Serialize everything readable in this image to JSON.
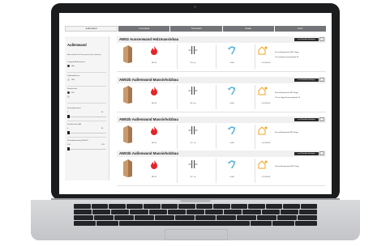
{
  "tabs": [
    {
      "label": "Außenwand",
      "active": true
    },
    {
      "label": "Innenwand",
      "active": false
    },
    {
      "label": "Trennwand",
      "active": false
    },
    {
      "label": "Decke",
      "active": false
    },
    {
      "label": "Dach",
      "active": false
    }
  ],
  "sidebar": {
    "title": "Außenwand",
    "description": "Bitte wählen Sie Ihre gewünschte Optionen",
    "group1_label": "Tragende Außenwand",
    "group1_opt": "Holz",
    "group2_label": "Gebäudeklasse",
    "group2_opt": "GK3",
    "group3_label": "Brandschutz",
    "group3_opt": "F30",
    "slider1_label": "Feuerwiderstand",
    "slider1_min": "0",
    "slider1_max": "90",
    "slider2_label": "Schallschutz (dB)",
    "slider2_min": "0",
    "slider2_max": "60",
    "slider3_label": "Wärmedämmung (W/m²K)",
    "slider3_min": "0,10",
    "slider3_max": "0,15"
  },
  "rows": [
    {
      "title": "AW02 Aussenwand Holzmassivbau",
      "button": "zum Datenblatt hinzufügen",
      "v1": "REI 30",
      "v2": "52,6 cm",
      "v3": "44 dB",
      "v4": "0,20 W/m²K",
      "desc1": "45 mm Brettsperrholz, BSP 3-lagig",
      "desc2": "75 mm Fgips-Feuerschutzplatte FF"
    },
    {
      "title": "AW02b Außenwand Massivholzbau",
      "button": "zum Datenblatt hinzufügen",
      "v1": "REI 30",
      "v2": "38,3 cm",
      "v3": "44 dB",
      "v4": "0,18 W/m²K",
      "desc1": "60 mm Brettsperrholz BSP 3-lagig",
      "desc2": "12,5 mm Fgips-Feuerschutzplatte FF"
    },
    {
      "title": "AW02b Außenwand Massivholzbau",
      "button": "zum Datenblatt hinzufügen",
      "v1": "REI 30",
      "v2": "31,7 cm",
      "v3": "44 dB",
      "v4": "0,20 W/m²K",
      "desc1": "60 mm Brettsperrholz BSP 3-lagig",
      "desc2": ""
    },
    {
      "title": "AW03b Außenwand Massivholzbau",
      "button": "zum Datenblatt hinzufügen",
      "v1": "REI 30",
      "v2": "28,7 cm",
      "v3": "44 dB",
      "v4": "0,20 W/m²K",
      "desc1": "100 mm Brettsperrholz BSP 5-lagig",
      "desc2": ""
    }
  ],
  "colors": {
    "fire": "#e3262a",
    "acoustic": "#2aa0c9",
    "thermal": "#f2a623",
    "structure": "#555555",
    "wood": "#c99a6d"
  }
}
